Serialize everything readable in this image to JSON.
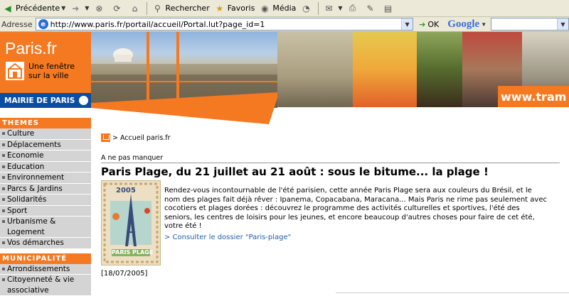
{
  "toolbar": {
    "back": "Précédente",
    "search": "Rechercher",
    "favorites": "Favoris",
    "media": "Média"
  },
  "address": {
    "label": "Adresse",
    "url": "http://www.paris.fr/portail/accueil/Portal.lut?page_id=1",
    "go": "OK",
    "search_engine": "Google"
  },
  "banner": {
    "logo": "Paris.fr",
    "tagline_1": "Une fenêtre",
    "tagline_2": "sur la ville",
    "mairie": "MAIRIE DE PARIS",
    "promo": "www.tram"
  },
  "sidebar": {
    "themes_heading": "THEMES",
    "themes": [
      "Culture",
      "Déplacements",
      "Economie",
      "Education",
      "Environnement",
      "Parcs & Jardins",
      "Solidarités",
      "Sport",
      "Urbanisme & Logement",
      "Vos démarches"
    ],
    "municipalite_heading": "MUNICIPALITÉ",
    "municipalite": [
      "Arrondissements",
      "Citoyenneté & vie associative"
    ]
  },
  "main": {
    "breadcrumb": "> Accueil paris.fr",
    "section": "A ne pas manquer",
    "headline": "Paris Plage, du 21 juillet au 21 août : sous le bitume... la plage !",
    "body_lines": [
      "Rendez-vous incontournable de l'été parisien, cette année Paris Plage sera aux couleurs du Brésil, et le",
      "nom des plages fait déjà rêver : Ipanema, Copacabana, Maracana... Mais Paris ne rime pas seulement avec",
      "cocotiers et plages dorées : découvrez  le programme des activités culturelles et sportives, l'été des",
      "seniors, les centres de loisirs pour les jeunes, et encore beaucoup d'autres choses pour faire de cet été,",
      "votre été !"
    ],
    "link": "> Consulter le dossier \"Paris-plage\"",
    "date": "[18/07/2005]",
    "poster_year": "2005",
    "poster_caption": "PARIS PLAGE"
  },
  "colors": {
    "brand_orange": "#f47920",
    "brand_blue": "#0b4da1",
    "link_blue": "#1f5fa8"
  }
}
